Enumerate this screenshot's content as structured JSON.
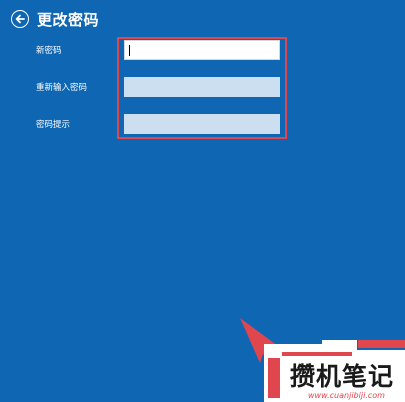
{
  "header": {
    "title": "更改密码",
    "back_icon": "back-arrow-icon"
  },
  "form": {
    "new_password_label": "新密码",
    "new_password_value": "",
    "confirm_password_label": "重新输入密码",
    "confirm_password_value": "",
    "hint_label": "密码提示",
    "hint_value": ""
  },
  "watermark": {
    "text": "攒机笔记",
    "url": "www.cuanjibiji.com"
  },
  "colors": {
    "background": "#0f66b3",
    "highlight": "#e0464d",
    "field_inactive": "#cbdff0",
    "field_active": "#ffffff"
  }
}
